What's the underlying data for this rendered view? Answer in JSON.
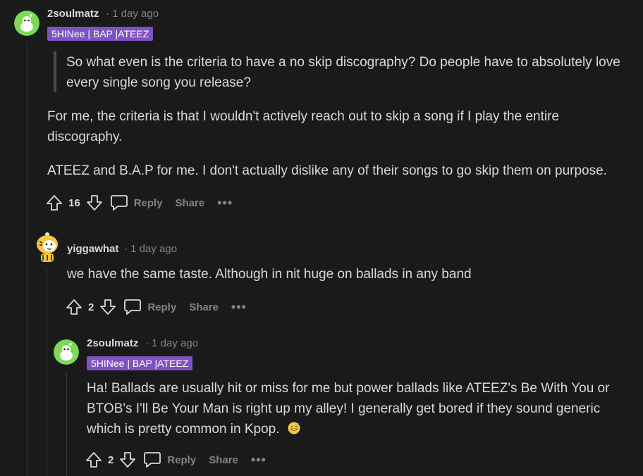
{
  "comment1": {
    "username": "2soulmatz",
    "meta": "· 1 day ago",
    "flair": "5HINee | BAP |ATEEZ",
    "quote": "So what even is the criteria to have a no skip discography? Do people have to absolutely love every single song you release?",
    "paragraph1": "For me, the criteria is that I wouldn't actively reach out to skip a song if I play the entire discography.",
    "paragraph2": "ATEEZ and B.A.P for me. I don't actually dislike any of their songs to go skip them on purpose.",
    "score": "16",
    "reply_label": "Reply",
    "share_label": "Share",
    "more_label": "•••"
  },
  "comment2": {
    "username": "yiggawhat",
    "meta": "· 1 day ago",
    "body": "we have the same taste. Although in nit huge on ballads in any band",
    "score": "2",
    "reply_label": "Reply",
    "share_label": "Share",
    "more_label": "•••"
  },
  "comment3": {
    "username": "2soulmatz",
    "meta": "· 1 day ago",
    "flair": "5HINee | BAP |ATEEZ",
    "body": "Ha! Ballads are usually hit or miss for me but power ballads like ATEEZ's Be With You or BTOB's I'll Be Your Man is right up my alley! I generally get bored if they sound generic which is pretty common in Kpop.",
    "emoji": "grinning-sweat-emoji",
    "score": "2",
    "reply_label": "Reply",
    "share_label": "Share",
    "more_label": "•••"
  },
  "colors": {
    "background": "#1a1a1b",
    "flair": "#7e53c1",
    "avatar_green": "#7ed957",
    "text": "#d7dadc",
    "muted": "#818384"
  }
}
